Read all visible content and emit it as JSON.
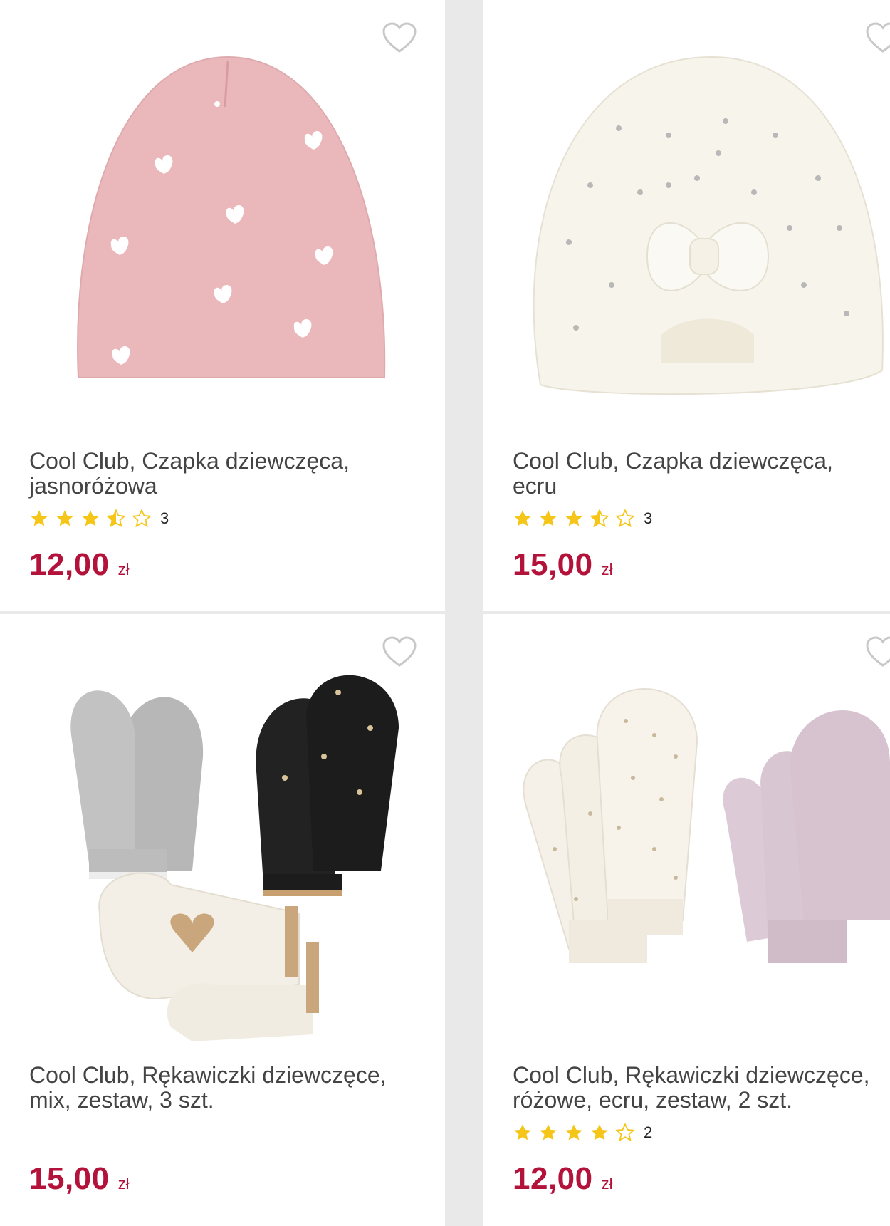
{
  "products": [
    {
      "title": "Cool Club, Czapka dziewczęca, jasnoróżowa",
      "rating": 3.5,
      "rating_count": "3",
      "price": "12,00",
      "currency": "zł",
      "image": "pink-beanie-hearts"
    },
    {
      "title": "Cool Club, Czapka dziewczęca, ecru",
      "rating": 3.5,
      "rating_count": "3",
      "price": "15,00",
      "currency": "zł",
      "image": "ecru-turban-bow"
    },
    {
      "title": "Cool Club, Rękawiczki dziewczęce, mix, zestaw, 3 szt.",
      "rating": null,
      "rating_count": "",
      "price": "15,00",
      "currency": "zł",
      "image": "mittens-set-3"
    },
    {
      "title": "Cool Club, Rękawiczki dziewczęce, różowe, ecru, zestaw, 2 szt.",
      "rating": 4,
      "rating_count": "2",
      "price": "12,00",
      "currency": "zł",
      "image": "mittens-set-2"
    }
  ],
  "colors": {
    "price": "#b3123a",
    "star": "#f5c518",
    "heart_outline": "#c8c8c8",
    "divider": "#e9e9e9"
  },
  "icons": {
    "favorite": "heart-outline-icon",
    "star_full": "star-full-icon",
    "star_half": "star-half-icon",
    "star_empty": "star-empty-icon"
  }
}
